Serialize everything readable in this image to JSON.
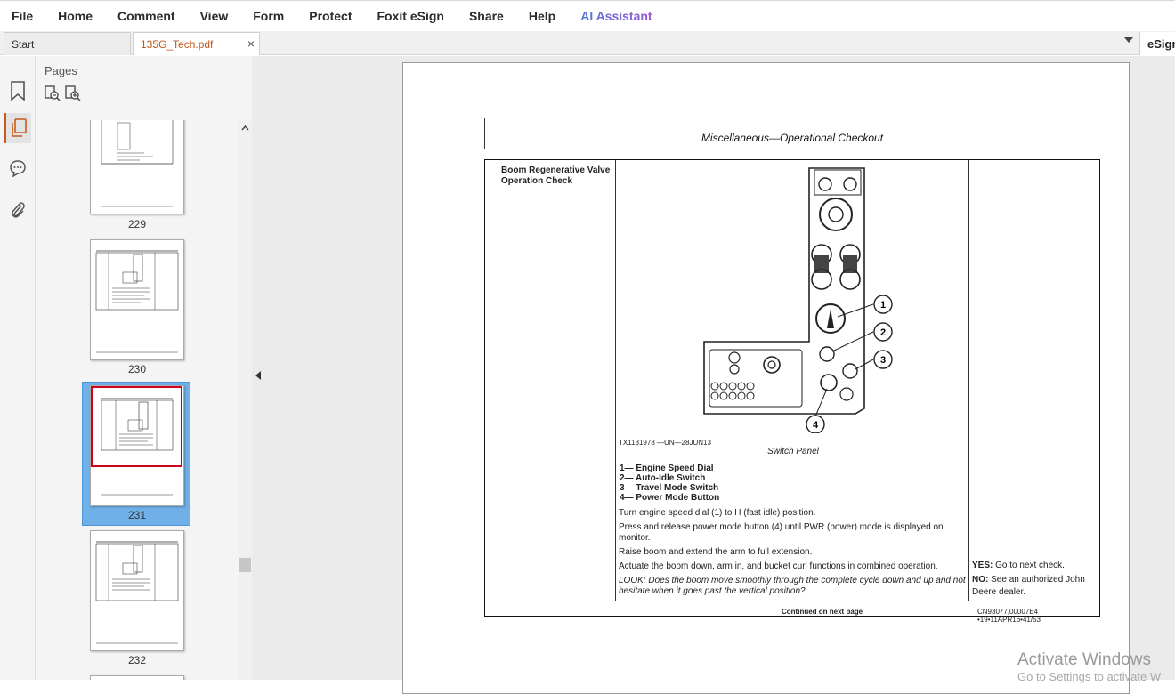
{
  "menu": [
    "File",
    "Home",
    "Comment",
    "View",
    "Form",
    "Protect",
    "Foxit eSign",
    "Share",
    "Help",
    "AI Assistant"
  ],
  "tabs": {
    "start": "Start",
    "document": "135G_Tech.pdf",
    "close_glyph": "×"
  },
  "esign_tab": "eSign",
  "pages_panel": {
    "title": "Pages",
    "thumbnails": [
      {
        "page": "229"
      },
      {
        "page": "230"
      },
      {
        "page": "231",
        "selected": true
      },
      {
        "page": "232"
      }
    ]
  },
  "document": {
    "header": "Miscellaneous—Operational Checkout",
    "check_title": "Boom Regenerative Valve Operation Check",
    "figure_ref": "TX1131978 —UN—28JUN13",
    "figure_caption": "Switch Panel",
    "callouts": [
      "1",
      "2",
      "3",
      "4"
    ],
    "legend": [
      "1— Engine Speed Dial",
      "2— Auto-Idle Switch",
      "3— Travel Mode Switch",
      "4— Power Mode Button"
    ],
    "steps": [
      "Turn engine speed dial (1) to H (fast idle) position.",
      "Press and release power mode button (4) until PWR (power) mode is displayed on monitor.",
      "Raise boom and extend the arm to full extension.",
      "Actuate the boom down, arm in, and bucket curl functions in combined operation."
    ],
    "look": "LOOK:  Does the boom move smoothly through the complete cycle down and up and not hesitate when it goes past the vertical position?",
    "result_yes_label": "YES:",
    "result_yes_text": " Go to next check.",
    "result_no_label": "NO:",
    "result_no_text": "  See an authorized John Deere dealer.",
    "continued": "Continued on next page",
    "code": "CN93077,00007E4 •19•11APR16•41/53"
  },
  "watermark": {
    "line1": "Activate Windows",
    "line2": "Go to Settings to activate W"
  },
  "colors": {
    "accent": "#c65b20",
    "selection": "#6fb0e8",
    "thumb_highlight": "#d0021b"
  }
}
